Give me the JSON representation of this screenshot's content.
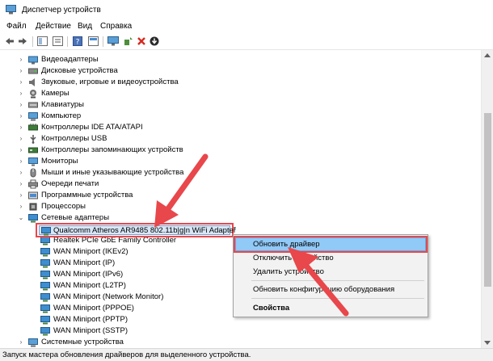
{
  "window": {
    "title": "Диспетчер устройств"
  },
  "menu": [
    "Файл",
    "Действие",
    "Вид",
    "Справка"
  ],
  "toolbar": [
    "back-icon",
    "forward-icon",
    "show-hide-tree-icon",
    "properties-icon",
    "help-icon",
    "action-icon",
    "scan-hardware-icon",
    "add-driver-icon",
    "uninstall-icon",
    "update-driver-icon"
  ],
  "tree": {
    "categories": [
      {
        "label": "Видеоадаптеры",
        "icon": "display-adapter-icon"
      },
      {
        "label": "Дисковые устройства",
        "icon": "disk-drive-icon"
      },
      {
        "label": "Звуковые, игровые и видеоустройства",
        "icon": "sound-icon"
      },
      {
        "label": "Камеры",
        "icon": "camera-icon"
      },
      {
        "label": "Клавиатуры",
        "icon": "keyboard-icon"
      },
      {
        "label": "Компьютер",
        "icon": "computer-icon"
      },
      {
        "label": "Контроллеры IDE ATA/ATAPI",
        "icon": "ide-controller-icon"
      },
      {
        "label": "Контроллеры USB",
        "icon": "usb-icon"
      },
      {
        "label": "Контроллеры запоминающих устройств",
        "icon": "storage-controller-icon"
      },
      {
        "label": "Мониторы",
        "icon": "monitor-icon"
      },
      {
        "label": "Мыши и иные указывающие устройства",
        "icon": "mouse-icon"
      },
      {
        "label": "Очереди печати",
        "icon": "printer-icon"
      },
      {
        "label": "Программные устройства",
        "icon": "software-device-icon"
      },
      {
        "label": "Процессоры",
        "icon": "processor-icon"
      }
    ],
    "network": {
      "label": "Сетевые адаптеры",
      "children": [
        "Qualcomm Atheros AR9485 802.11b|g|n WiFi Adapter",
        "Realtek PCIe GbE Family Controller",
        "WAN Miniport (IKEv2)",
        "WAN Miniport (IP)",
        "WAN Miniport (IPv6)",
        "WAN Miniport (L2TP)",
        "WAN Miniport (Network Monitor)",
        "WAN Miniport (PPPOE)",
        "WAN Miniport (PPTP)",
        "WAN Miniport (SSTP)"
      ]
    },
    "after": [
      {
        "label": "Системные устройства",
        "icon": "system-device-icon"
      }
    ]
  },
  "context_menu": {
    "items": [
      "Обновить драйвер",
      "Отключить устройство",
      "Удалить устройство",
      "Обновить конфигурацию оборудования",
      "Свойства"
    ]
  },
  "status": "Запуск мастера обновления драйверов для выделенного устройства.",
  "colors": {
    "annotation_red": "#e8474b",
    "hover_blue": "#91c9f7",
    "selection_blue": "#d8e6f6"
  }
}
